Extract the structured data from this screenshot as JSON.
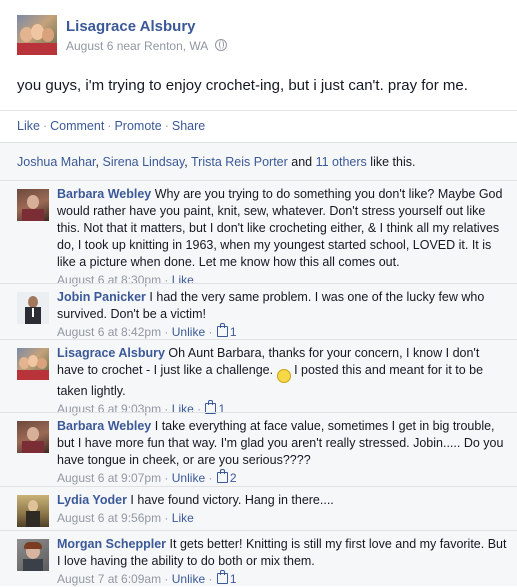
{
  "post": {
    "author": "Lisagrace Alsbury",
    "date": "August 6 near Renton, WA",
    "text": "you guys, i'm trying to enjoy crochet-ing, but i just can't. pray for me."
  },
  "actions": {
    "like": "Like",
    "comment": "Comment",
    "promote": "Promote",
    "share": "Share",
    "separator": "·"
  },
  "likes": {
    "name1": "Joshua Mahar",
    "name2": "Sirena Lindsay",
    "name3": "Trista Reis Porter",
    "and": "and",
    "others": "11 others",
    "suffix": "like this.",
    "comma": ","
  },
  "comments": [
    {
      "name": "Barbara Webley",
      "text": "Why are you trying to do something you don't like? Maybe God would rather have you paint, knit, sew, whatever. Don't stress yourself out like this. Not that it matters, but I don't like crocheting either, & I think all my relatives do, I took up knitting in 1963, when my youngest started school, LOVED it. It is like a picture when done. Let me know how this all comes out.",
      "time": "August 6 at 8:30pm",
      "like_label": "Like",
      "likes": ""
    },
    {
      "name": "Jobin Panicker",
      "text": "I had the very same problem. I was one of the lucky few who survived. Don't be a victim!",
      "time": "August 6 at 8:42pm",
      "like_label": "Unlike",
      "likes": "1"
    },
    {
      "name": "Lisagrace Alsbury",
      "text_before": "Oh Aunt Barbara, thanks for your concern, I know I don't have to crochet - I just like a challenge.",
      "emoticon": ":)",
      "text_after": "I posted this and meant for it to be taken lightly.",
      "time": "August 6 at 9:03pm",
      "like_label": "Like",
      "likes": "1"
    },
    {
      "name": "Barbara Webley",
      "text": "I take everything at face value, sometimes I get in big trouble, but I have more fun that way. I'm glad you aren't really stressed. Jobin..... Do you have tongue in cheek, or are you serious????",
      "time": "August 6 at 9:07pm",
      "like_label": "Unlike",
      "likes": "2"
    },
    {
      "name": "Lydia Yoder",
      "text": "I have found victory. Hang in there....",
      "time": "August 6 at 9:56pm",
      "like_label": "Like",
      "likes": ""
    },
    {
      "name": "Morgan Scheppler",
      "text": "It gets better! Knitting is still my first love and my favorite. But I love having the ability to do both or mix them.",
      "time": "August 7 at 6:09am",
      "like_label": "Unlike",
      "likes": "1"
    }
  ],
  "meta_separator": "·",
  "colors": {
    "link": "#3b5998",
    "meta": "#9197a3",
    "ufi_background": "#f6f7f8"
  }
}
